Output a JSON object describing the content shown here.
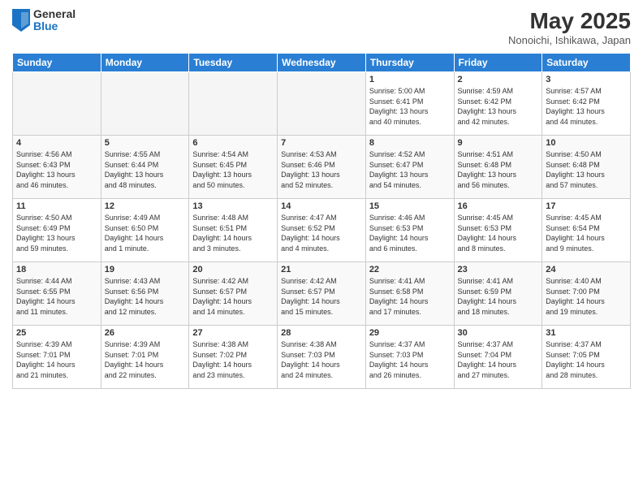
{
  "logo": {
    "general": "General",
    "blue": "Blue"
  },
  "header": {
    "title": "May 2025",
    "location": "Nonoichi, Ishikawa, Japan"
  },
  "weekdays": [
    "Sunday",
    "Monday",
    "Tuesday",
    "Wednesday",
    "Thursday",
    "Friday",
    "Saturday"
  ],
  "weeks": [
    [
      {
        "day": "",
        "info": ""
      },
      {
        "day": "",
        "info": ""
      },
      {
        "day": "",
        "info": ""
      },
      {
        "day": "",
        "info": ""
      },
      {
        "day": "1",
        "info": "Sunrise: 5:00 AM\nSunset: 6:41 PM\nDaylight: 13 hours\nand 40 minutes."
      },
      {
        "day": "2",
        "info": "Sunrise: 4:59 AM\nSunset: 6:42 PM\nDaylight: 13 hours\nand 42 minutes."
      },
      {
        "day": "3",
        "info": "Sunrise: 4:57 AM\nSunset: 6:42 PM\nDaylight: 13 hours\nand 44 minutes."
      }
    ],
    [
      {
        "day": "4",
        "info": "Sunrise: 4:56 AM\nSunset: 6:43 PM\nDaylight: 13 hours\nand 46 minutes."
      },
      {
        "day": "5",
        "info": "Sunrise: 4:55 AM\nSunset: 6:44 PM\nDaylight: 13 hours\nand 48 minutes."
      },
      {
        "day": "6",
        "info": "Sunrise: 4:54 AM\nSunset: 6:45 PM\nDaylight: 13 hours\nand 50 minutes."
      },
      {
        "day": "7",
        "info": "Sunrise: 4:53 AM\nSunset: 6:46 PM\nDaylight: 13 hours\nand 52 minutes."
      },
      {
        "day": "8",
        "info": "Sunrise: 4:52 AM\nSunset: 6:47 PM\nDaylight: 13 hours\nand 54 minutes."
      },
      {
        "day": "9",
        "info": "Sunrise: 4:51 AM\nSunset: 6:48 PM\nDaylight: 13 hours\nand 56 minutes."
      },
      {
        "day": "10",
        "info": "Sunrise: 4:50 AM\nSunset: 6:48 PM\nDaylight: 13 hours\nand 57 minutes."
      }
    ],
    [
      {
        "day": "11",
        "info": "Sunrise: 4:50 AM\nSunset: 6:49 PM\nDaylight: 13 hours\nand 59 minutes."
      },
      {
        "day": "12",
        "info": "Sunrise: 4:49 AM\nSunset: 6:50 PM\nDaylight: 14 hours\nand 1 minute."
      },
      {
        "day": "13",
        "info": "Sunrise: 4:48 AM\nSunset: 6:51 PM\nDaylight: 14 hours\nand 3 minutes."
      },
      {
        "day": "14",
        "info": "Sunrise: 4:47 AM\nSunset: 6:52 PM\nDaylight: 14 hours\nand 4 minutes."
      },
      {
        "day": "15",
        "info": "Sunrise: 4:46 AM\nSunset: 6:53 PM\nDaylight: 14 hours\nand 6 minutes."
      },
      {
        "day": "16",
        "info": "Sunrise: 4:45 AM\nSunset: 6:53 PM\nDaylight: 14 hours\nand 8 minutes."
      },
      {
        "day": "17",
        "info": "Sunrise: 4:45 AM\nSunset: 6:54 PM\nDaylight: 14 hours\nand 9 minutes."
      }
    ],
    [
      {
        "day": "18",
        "info": "Sunrise: 4:44 AM\nSunset: 6:55 PM\nDaylight: 14 hours\nand 11 minutes."
      },
      {
        "day": "19",
        "info": "Sunrise: 4:43 AM\nSunset: 6:56 PM\nDaylight: 14 hours\nand 12 minutes."
      },
      {
        "day": "20",
        "info": "Sunrise: 4:42 AM\nSunset: 6:57 PM\nDaylight: 14 hours\nand 14 minutes."
      },
      {
        "day": "21",
        "info": "Sunrise: 4:42 AM\nSunset: 6:57 PM\nDaylight: 14 hours\nand 15 minutes."
      },
      {
        "day": "22",
        "info": "Sunrise: 4:41 AM\nSunset: 6:58 PM\nDaylight: 14 hours\nand 17 minutes."
      },
      {
        "day": "23",
        "info": "Sunrise: 4:41 AM\nSunset: 6:59 PM\nDaylight: 14 hours\nand 18 minutes."
      },
      {
        "day": "24",
        "info": "Sunrise: 4:40 AM\nSunset: 7:00 PM\nDaylight: 14 hours\nand 19 minutes."
      }
    ],
    [
      {
        "day": "25",
        "info": "Sunrise: 4:39 AM\nSunset: 7:01 PM\nDaylight: 14 hours\nand 21 minutes."
      },
      {
        "day": "26",
        "info": "Sunrise: 4:39 AM\nSunset: 7:01 PM\nDaylight: 14 hours\nand 22 minutes."
      },
      {
        "day": "27",
        "info": "Sunrise: 4:38 AM\nSunset: 7:02 PM\nDaylight: 14 hours\nand 23 minutes."
      },
      {
        "day": "28",
        "info": "Sunrise: 4:38 AM\nSunset: 7:03 PM\nDaylight: 14 hours\nand 24 minutes."
      },
      {
        "day": "29",
        "info": "Sunrise: 4:37 AM\nSunset: 7:03 PM\nDaylight: 14 hours\nand 26 minutes."
      },
      {
        "day": "30",
        "info": "Sunrise: 4:37 AM\nSunset: 7:04 PM\nDaylight: 14 hours\nand 27 minutes."
      },
      {
        "day": "31",
        "info": "Sunrise: 4:37 AM\nSunset: 7:05 PM\nDaylight: 14 hours\nand 28 minutes."
      }
    ]
  ]
}
